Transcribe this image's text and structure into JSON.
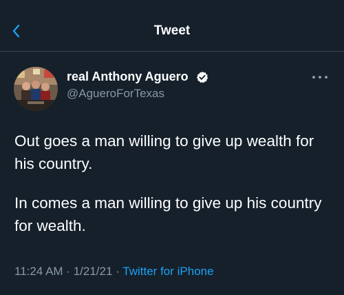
{
  "header": {
    "title": "Tweet"
  },
  "author": {
    "name": "real Anthony Aguero",
    "handle": "@AgueroForTexas",
    "verified": true
  },
  "tweet": {
    "paragraphs": [
      "Out goes a man willing to give up wealth for his country.",
      "In comes a man willing to give up his country for wealth."
    ],
    "time": "11:24 AM",
    "date": "1/21/21",
    "separator": "·",
    "source": "Twitter for iPhone"
  },
  "colors": {
    "background": "#15202b",
    "accent": "#1da1f2",
    "secondary_text": "#8899a6",
    "divider": "#38444d"
  },
  "icons": {
    "back": "chevron-left-icon",
    "verified": "verified-badge-icon",
    "more": "more-options-icon"
  }
}
